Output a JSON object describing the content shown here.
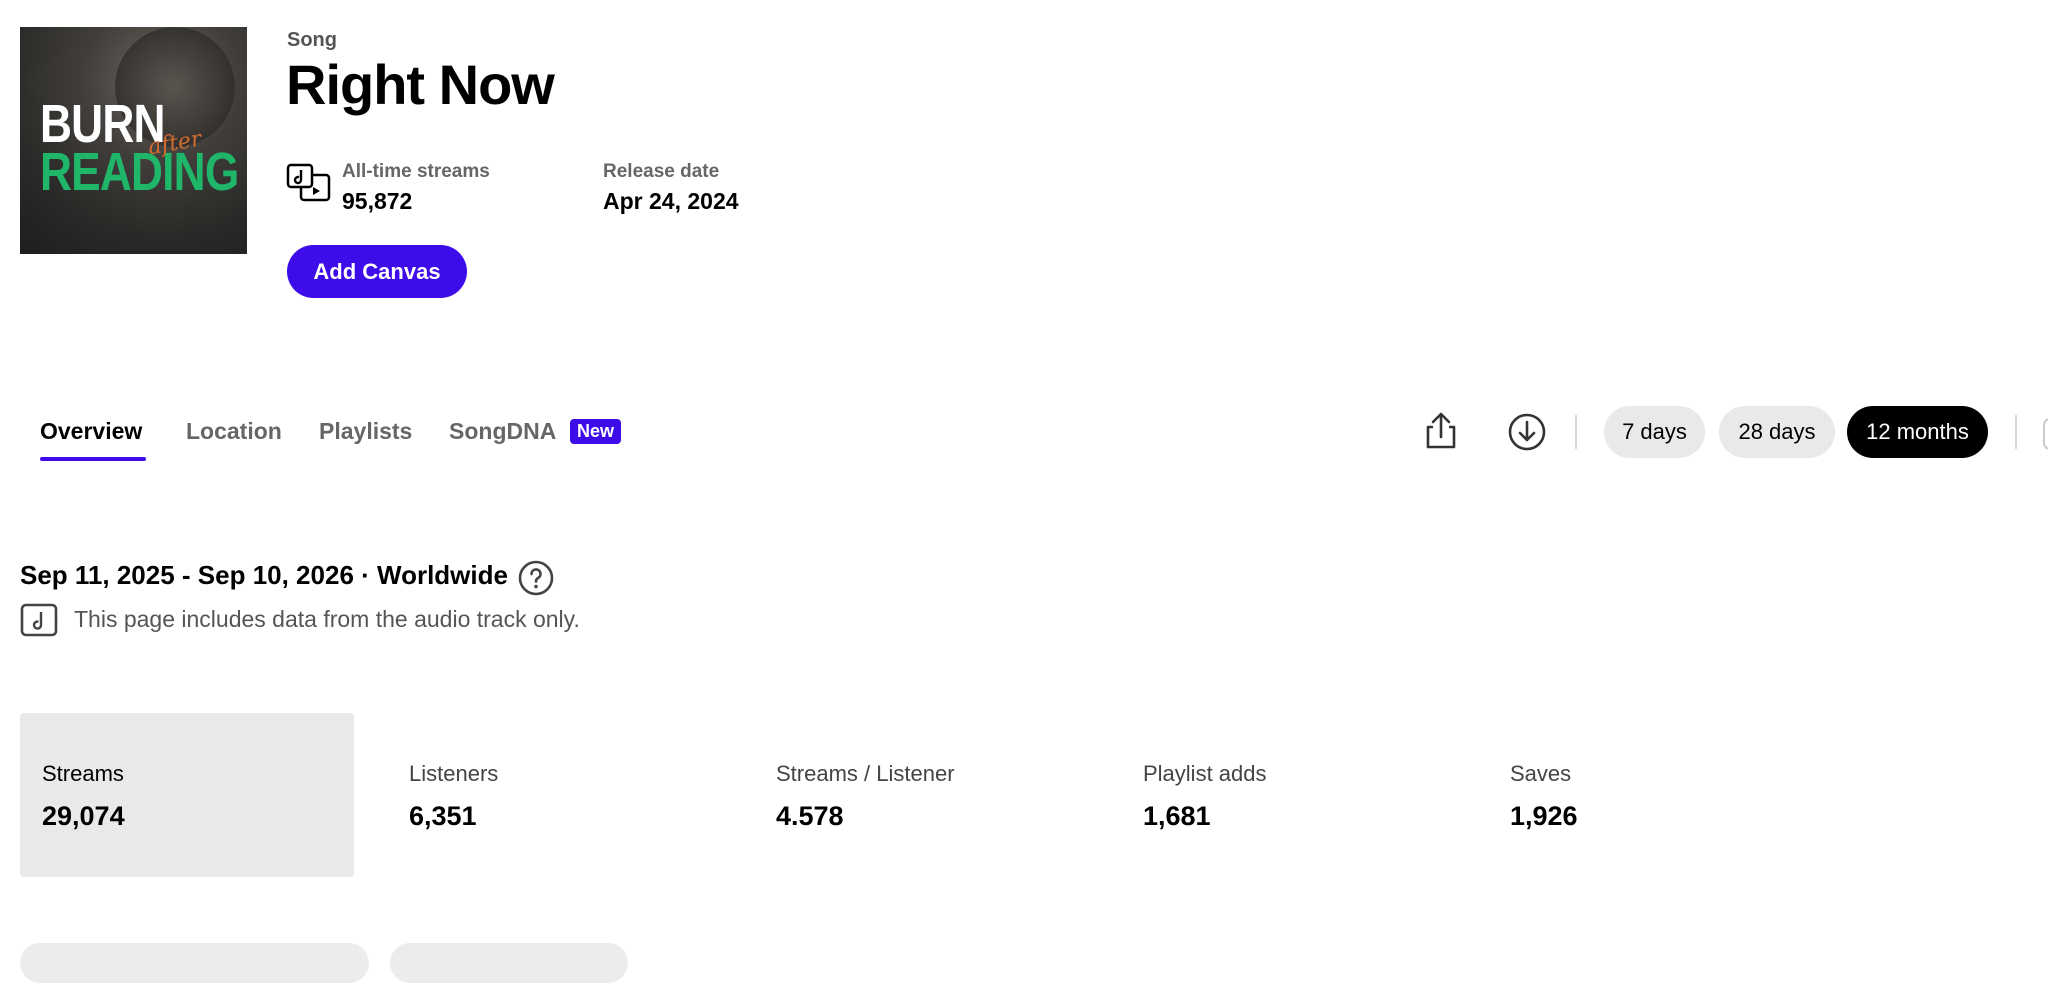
{
  "song": {
    "kind_label": "Song",
    "title": "Right Now",
    "cover": {
      "line1": "BURN",
      "line2": "READING",
      "script": "after"
    },
    "all_time_streams_label": "All-time streams",
    "all_time_streams_value": "95,872",
    "release_date_label": "Release date",
    "release_date_value": "Apr 24, 2024",
    "add_canvas_label": "Add Canvas"
  },
  "tabs": [
    {
      "label": "Overview",
      "active": true
    },
    {
      "label": "Location"
    },
    {
      "label": "Playlists"
    },
    {
      "label": "SongDNA",
      "badge": "New"
    }
  ],
  "time_ranges": [
    {
      "label": "7 days"
    },
    {
      "label": "28 days"
    },
    {
      "label": "12 months",
      "active": true
    }
  ],
  "range_heading": "Sep 11, 2025 - Sep 10, 2026 · Worldwide",
  "audio_note": "This page includes data from the audio track only.",
  "metrics": [
    {
      "label": "Streams",
      "value": "29,074",
      "selected": true
    },
    {
      "label": "Listeners",
      "value": "6,351"
    },
    {
      "label": "Streams / Listener",
      "value": "4.578"
    },
    {
      "label": "Playlist adds",
      "value": "1,681"
    },
    {
      "label": "Saves",
      "value": "1,926"
    }
  ],
  "colors": {
    "accent": "#3d0ce8",
    "pill_bg": "#e9e9e9",
    "cover_green": "#1fb66a",
    "cover_orange": "#d56d2f"
  },
  "icons": [
    "audio-video-icon",
    "share-icon",
    "download-icon",
    "help-icon",
    "audio-track-icon"
  ]
}
